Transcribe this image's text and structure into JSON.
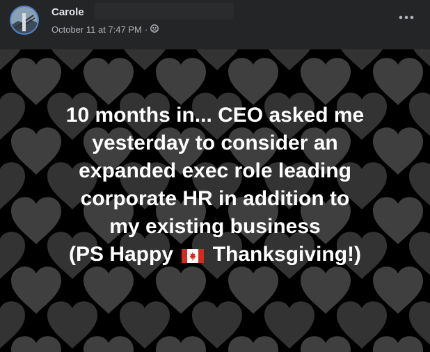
{
  "post": {
    "author": "Carole",
    "timestamp": "October 11 at 7:47 PM",
    "separator": "·",
    "privacy_icon": "friends-globe-icon",
    "more_icon": "more-options-icon"
  },
  "content": {
    "background": "dark-hearts-pattern",
    "lines": [
      "10 months in... CEO asked me",
      "yesterday to consider an",
      "expanded exec role leading",
      "corporate HR in addition to",
      "my existing business"
    ],
    "last_line_prefix": "(PS Happy",
    "flag_icon": "canada-flag-icon",
    "last_line_suffix": "Thanksgiving!)"
  },
  "colors": {
    "header_bg": "#242526",
    "text_primary": "#e4e6eb",
    "text_secondary": "#b0b3b8",
    "avatar_ring": "#4f82c9"
  }
}
